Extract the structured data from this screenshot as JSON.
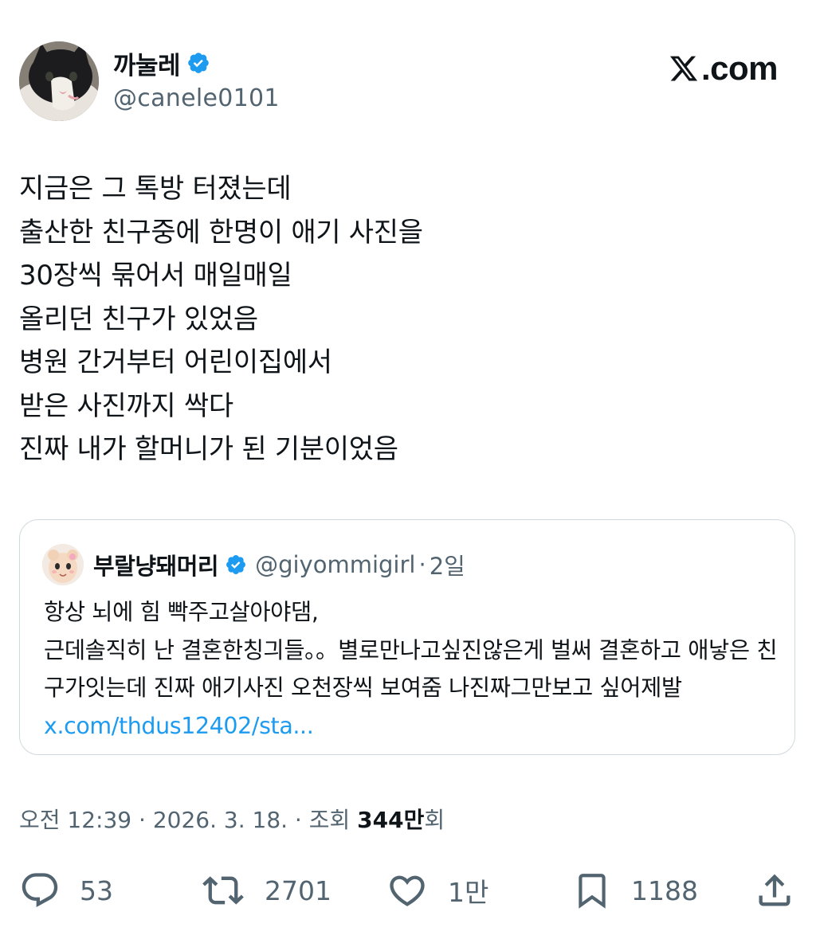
{
  "site": {
    "logo_suffix": ".com"
  },
  "author": {
    "display_name": "까눌레",
    "handle": "@canele0101",
    "verified": true
  },
  "tweet": {
    "text": "지금은 그 톡방 터졌는데\n출산한 친구중에 한명이 애기 사진을\n30장씩 묶어서 매일매일\n올리던 친구가 있었음\n병원 간거부터 어린이집에서\n받은 사진까지 싹다\n진짜 내가 할머니가 된 기분이었음"
  },
  "quote": {
    "display_name": "부랄냥돼머리",
    "handle": "@giyommigirl",
    "separator": "·",
    "time": "2일",
    "text": "항상 뇌에 힘 빡주고살아야댐,\n근데솔직히 난 결혼한칭긔들。。별로만나고싶진않은게 벌써 결혼하고 애낳은 친구가잇는데 진짜 애기사진 오천장씩 보여줌 나진짜그만보고 싶어제발 ",
    "link": "x.com/thdus12402/sta..."
  },
  "meta": {
    "time": "오전 12:39",
    "sep1": " · ",
    "date": "2026. 3. 18.",
    "sep2": " · ",
    "views_label": "조회 ",
    "views_count": "344만",
    "views_suffix": "회"
  },
  "actions": {
    "replies": "53",
    "reposts": "2701",
    "likes": "1만",
    "bookmarks": "1188"
  },
  "colors": {
    "verified": "#1d9bf0",
    "link": "#1d9bf0",
    "secondary_text": "#536471",
    "border": "#cfd9de"
  },
  "icons": [
    "verified-badge-icon",
    "x-logo-icon",
    "reply-icon",
    "repost-icon",
    "like-icon",
    "bookmark-icon",
    "share-icon"
  ]
}
